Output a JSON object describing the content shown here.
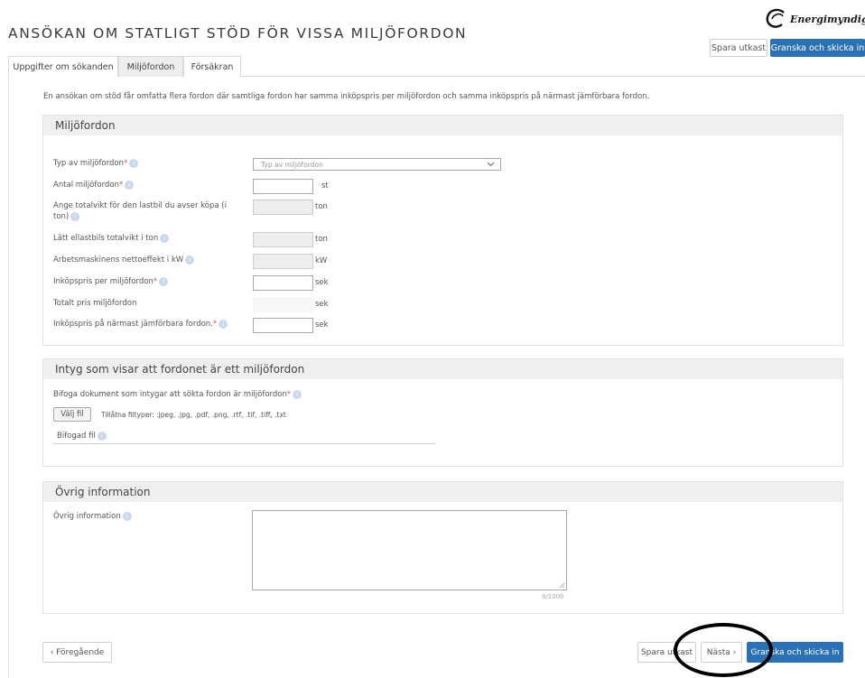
{
  "header": {
    "title": "ANSÖKAN OM STATLIGT STÖD FÖR VISSA MILJÖFORDON",
    "logo_text": "Energimyndigheten",
    "save_draft": "Spara utkast",
    "review_submit": "Granska och skicka in"
  },
  "tabs": [
    {
      "label": "Uppgifter om sökanden"
    },
    {
      "label": "Miljöfordon"
    },
    {
      "label": "Försäkran"
    }
  ],
  "intro": "En ansökan om stöd får omfatta flera fordon där samtliga fordon har samma inköpspris per miljöfordon och samma inköpspris på närmast jämförbara fordon.",
  "vehicles": {
    "heading": "Miljöfordon",
    "type_label": "Typ av miljöfordon",
    "type_placeholder": "Typ av miljöfordon",
    "count_label": "Antal miljöfordon",
    "count_unit": "st",
    "weight_label": "Ange totalvikt för den lastbil du avser köpa (i ton)",
    "weight_unit": "ton",
    "light_weight_label": "Lätt ellastbils totalvikt i ton",
    "light_weight_unit": "ton",
    "power_label": "Arbetsmaskinens nettoeffekt i kW",
    "power_unit": "kW",
    "price_label": "Inköpspris per miljöfordon",
    "price_unit": "sek",
    "total_label": "Totalt pris miljöfordon",
    "total_unit": "sek",
    "compare_label": "Inköpspris på närmast jämförbara fordon.",
    "compare_unit": "sek"
  },
  "certificate": {
    "heading": "Intyg som visar att fordonet är ett miljöfordon",
    "attach_label": "Bifoga dokument som intygar att sökta fordon är miljöfordon",
    "choose_file": "Välj fil",
    "allowed_types": "Tillåtna filtyper: .jpeg, .jpg, .pdf, .png, .rtf, .tif, .tiff, .txt",
    "attached_file": "Bifogad fil"
  },
  "other": {
    "heading": "Övrig information",
    "label": "Övrig information",
    "counter": "0/2000"
  },
  "footer": {
    "previous": "‹ Föregående",
    "save_draft": "Spara utkast",
    "next": "Nästa ›",
    "review_submit": "Granska och skicka in"
  },
  "colors": {
    "primary": "#2a72b5",
    "required": "#d9534f",
    "section_header": "#efefef"
  }
}
